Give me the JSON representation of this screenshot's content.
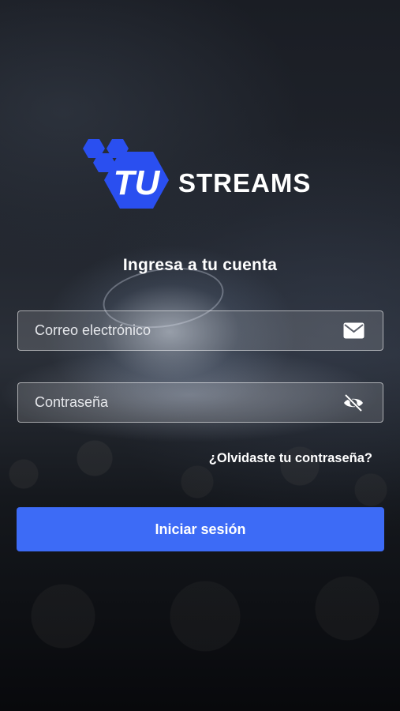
{
  "logo": {
    "mark_text": "TU",
    "word_text": "STREAMS"
  },
  "login": {
    "title": "Ingresa a tu cuenta",
    "email_placeholder": "Correo electrónico",
    "email_icon": "mail-icon",
    "password_placeholder": "Contraseña",
    "password_icon": "eye-off-icon",
    "forgot_label": "¿Olvidaste tu contraseña?",
    "submit_label": "Iniciar sesión"
  },
  "colors": {
    "primary_button": "#3d6bf6",
    "logo_blue": "#2a4ff0",
    "text": "#ffffff"
  }
}
